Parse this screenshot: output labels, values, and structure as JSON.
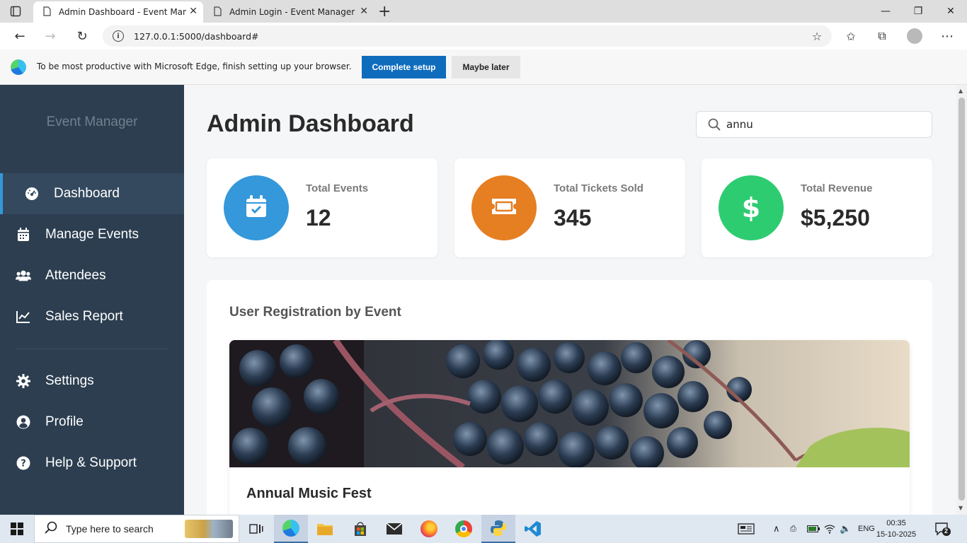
{
  "browser": {
    "tabs": [
      {
        "title": "Admin Dashboard - Event Manag",
        "active": true
      },
      {
        "title": "Admin Login - Event Manager",
        "active": false
      }
    ],
    "url": "127.0.0.1:5000/dashboard#"
  },
  "infobar": {
    "message": "To be most productive with Microsoft Edge, finish setting up your browser.",
    "complete_label": "Complete setup",
    "later_label": "Maybe later"
  },
  "sidebar": {
    "brand": "Event Manager",
    "items": [
      {
        "label": "Dashboard",
        "icon": "tachometer-icon",
        "active": true
      },
      {
        "label": "Manage Events",
        "icon": "calendar-icon"
      },
      {
        "label": "Attendees",
        "icon": "users-icon"
      },
      {
        "label": "Sales Report",
        "icon": "line-chart-icon"
      },
      {
        "label": "Settings",
        "icon": "gear-icon"
      },
      {
        "label": "Profile",
        "icon": "user-circle-icon"
      },
      {
        "label": "Help & Support",
        "icon": "question-circle-icon"
      }
    ]
  },
  "main": {
    "title": "Admin Dashboard",
    "search_value": "annu",
    "stats": [
      {
        "label": "Total Events",
        "value": "12",
        "color": "#3498db",
        "icon": "calendar-check-icon"
      },
      {
        "label": "Total Tickets Sold",
        "value": "345",
        "color": "#e67e22",
        "icon": "ticket-icon"
      },
      {
        "label": "Total Revenue",
        "value": "$5,250",
        "color": "#2ecc71",
        "icon": "dollar-icon"
      }
    ],
    "panel_title": "User Registration by Event",
    "event_title": "Annual Music Fest"
  },
  "taskbar": {
    "search_placeholder": "Type here to search",
    "language": "ENG",
    "time": "00:35",
    "date": "15-10-2025",
    "notifications": "2"
  }
}
